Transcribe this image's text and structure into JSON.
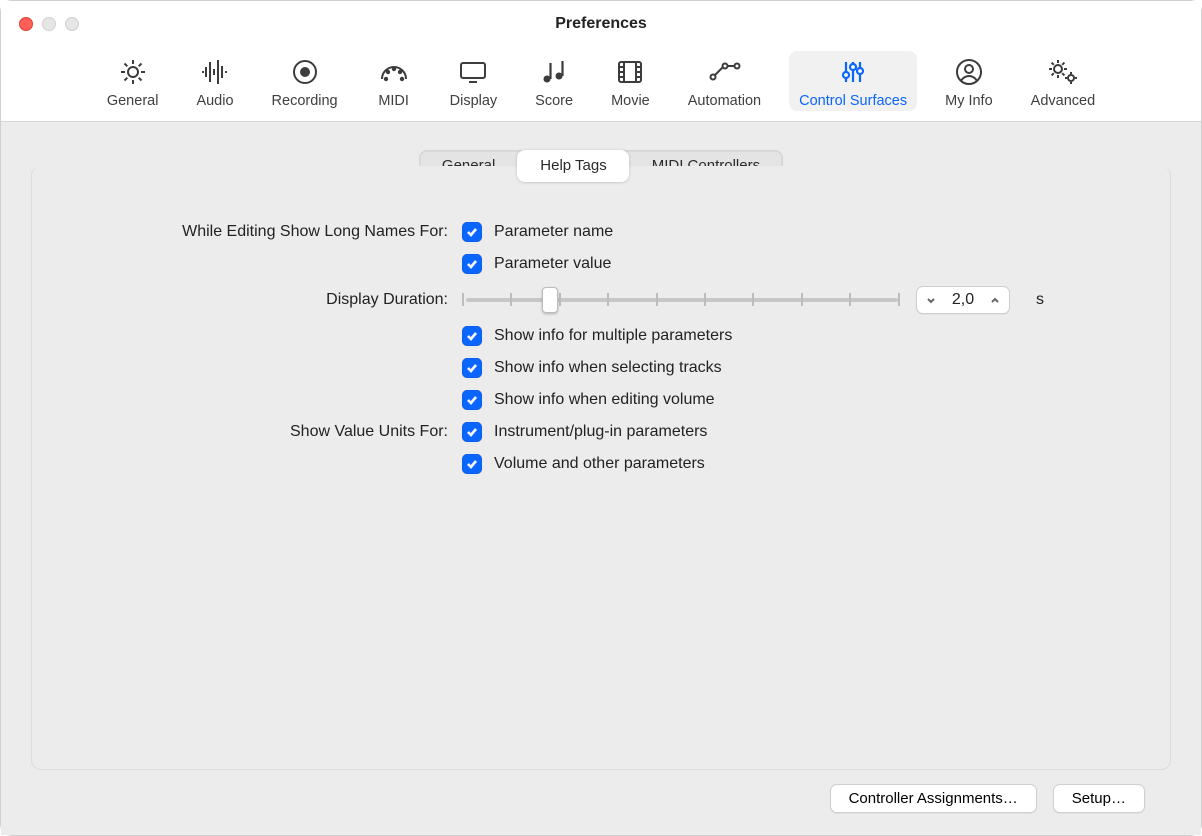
{
  "window": {
    "title": "Preferences"
  },
  "toolbar": {
    "items": [
      {
        "label": "General",
        "icon": "gear"
      },
      {
        "label": "Audio",
        "icon": "wave"
      },
      {
        "label": "Recording",
        "icon": "dot"
      },
      {
        "label": "MIDI",
        "icon": "gauge"
      },
      {
        "label": "Display",
        "icon": "monitor"
      },
      {
        "label": "Score",
        "icon": "notes"
      },
      {
        "label": "Movie",
        "icon": "film"
      },
      {
        "label": "Automation",
        "icon": "nodes"
      },
      {
        "label": "Control Surfaces",
        "icon": "sliders",
        "selected": true
      },
      {
        "label": "My Info",
        "icon": "person"
      },
      {
        "label": "Advanced",
        "icon": "gears"
      }
    ]
  },
  "segments": {
    "items": [
      {
        "label": "General"
      },
      {
        "label": "Help Tags",
        "active": true
      },
      {
        "label": "MIDI Controllers"
      }
    ]
  },
  "form": {
    "editLongNamesLabel": "While Editing Show Long Names For:",
    "paramName": {
      "checked": true,
      "label": "Parameter name"
    },
    "paramValue": {
      "checked": true,
      "label": "Parameter value"
    },
    "displayDurationLabel": "Display Duration:",
    "displayDurationValue": "2,0",
    "displayDurationUnit": "s",
    "opts": [
      {
        "checked": true,
        "label": "Show info for multiple parameters"
      },
      {
        "checked": true,
        "label": "Show info when selecting tracks"
      },
      {
        "checked": true,
        "label": "Show info when editing volume"
      }
    ],
    "showValueUnitsLabel": "Show Value Units For:",
    "units": [
      {
        "checked": true,
        "label": "Instrument/plug-in parameters"
      },
      {
        "checked": true,
        "label": "Volume and other parameters"
      }
    ]
  },
  "footer": {
    "controllerAssignments": "Controller Assignments…",
    "setup": "Setup…"
  }
}
